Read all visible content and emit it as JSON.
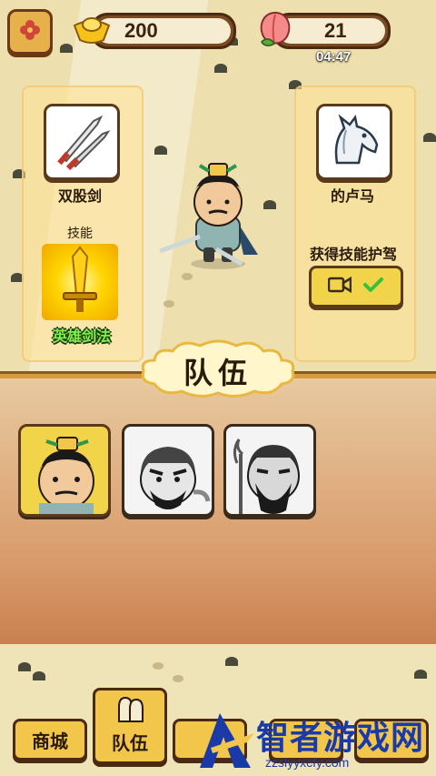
{
  "header": {
    "gold_value": "200",
    "peach_value": "21",
    "timer": "04:47"
  },
  "left_panel": {
    "weapon_name": "双股剑",
    "skill_heading": "技能",
    "skill_name": "英雄剑法"
  },
  "right_panel": {
    "mount_name": "的卢马",
    "get_skill_text": "获得技能护驾"
  },
  "team": {
    "title": "队伍"
  },
  "nav": {
    "shop_label": "商城",
    "team_label": "队伍"
  },
  "watermark": {
    "title": "智者游戏网",
    "url": "zzslyyxcfy.com"
  },
  "colors": {
    "accent": "#f2d44a",
    "brown": "#5a3a1a",
    "skill_green": "#7ff04a"
  }
}
